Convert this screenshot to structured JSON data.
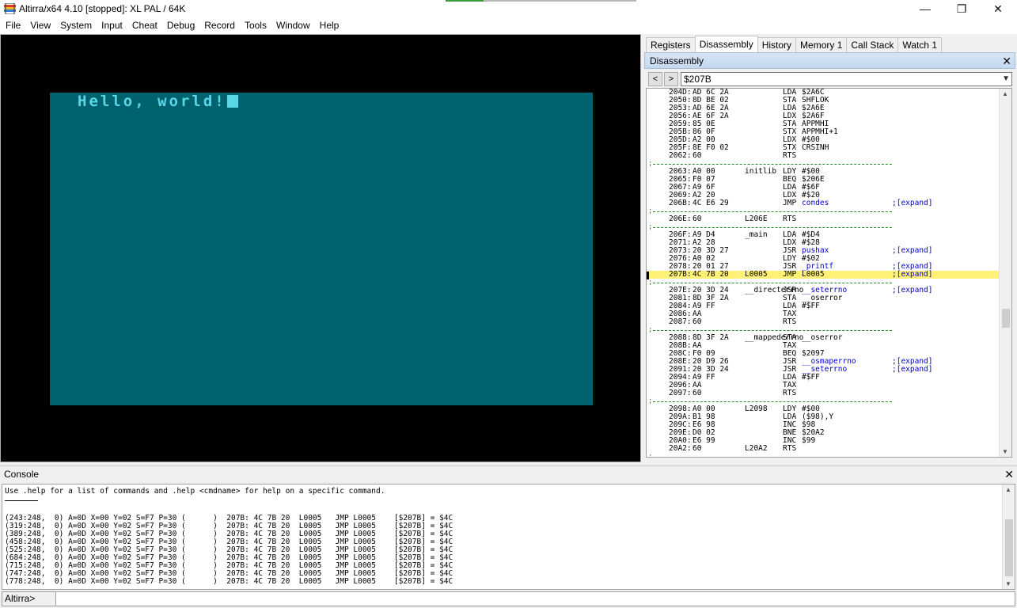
{
  "window": {
    "title": "Altirra/x64 4.10 [stopped]: XL PAL / 64K",
    "minimize": "—",
    "restore": "❐",
    "close": "✕"
  },
  "menu": [
    "File",
    "View",
    "System",
    "Input",
    "Cheat",
    "Debug",
    "Record",
    "Tools",
    "Window",
    "Help"
  ],
  "screen": {
    "text": "Hello, world!",
    "background_color": "#00616f",
    "text_color": "#5ad6e6"
  },
  "tabs": [
    "Registers",
    "Disassembly",
    "History",
    "Memory 1",
    "Call Stack",
    "Watch 1"
  ],
  "active_tab": "Disassembly",
  "disasm": {
    "title": "Disassembly",
    "close": "✕",
    "back": "<",
    "forward": ">",
    "address": "$207B",
    "highlight_color": "#fff176",
    "lines": [
      {
        "t": "code",
        "addr": "204D:",
        "bytes": "AD 6C 2A",
        "label": "",
        "op": "LDA",
        "arg": "$2A6C",
        "exp": ""
      },
      {
        "t": "code",
        "addr": "2050:",
        "bytes": "8D BE 02",
        "label": "",
        "op": "STA",
        "arg": "SHFLOK",
        "exp": ""
      },
      {
        "t": "code",
        "addr": "2053:",
        "bytes": "AD 6E 2A",
        "label": "",
        "op": "LDA",
        "arg": "$2A6E",
        "exp": ""
      },
      {
        "t": "code",
        "addr": "2056:",
        "bytes": "AE 6F 2A",
        "label": "",
        "op": "LDX",
        "arg": "$2A6F",
        "exp": ""
      },
      {
        "t": "code",
        "addr": "2059:",
        "bytes": "85 0E",
        "label": "",
        "op": "STA",
        "arg": "APPMHI",
        "exp": ""
      },
      {
        "t": "code",
        "addr": "205B:",
        "bytes": "86 0F",
        "label": "",
        "op": "STX",
        "arg": "APPMHI+1",
        "exp": ""
      },
      {
        "t": "code",
        "addr": "205D:",
        "bytes": "A2 00",
        "label": "",
        "op": "LDX",
        "arg": "#$00",
        "exp": ""
      },
      {
        "t": "code",
        "addr": "205F:",
        "bytes": "8E F0 02",
        "label": "",
        "op": "STX",
        "arg": "CRSINH",
        "exp": ""
      },
      {
        "t": "code",
        "addr": "2062:",
        "bytes": "60",
        "label": "",
        "op": "RTS",
        "arg": "",
        "exp": ""
      },
      {
        "t": "sep"
      },
      {
        "t": "code",
        "addr": "2063:",
        "bytes": "A0 00",
        "label": "initlib",
        "op": "LDY",
        "arg": "#$00",
        "exp": ""
      },
      {
        "t": "code",
        "addr": "2065:",
        "bytes": "F0 07",
        "label": "",
        "op": "BEQ",
        "arg": "$206E",
        "exp": ""
      },
      {
        "t": "code",
        "addr": "2067:",
        "bytes": "A9 6F",
        "label": "",
        "op": "LDA",
        "arg": "#$6F",
        "exp": ""
      },
      {
        "t": "code",
        "addr": "2069:",
        "bytes": "A2 20",
        "label": "",
        "op": "LDX",
        "arg": "#$20",
        "exp": ""
      },
      {
        "t": "code",
        "addr": "206B:",
        "bytes": "4C E6 29",
        "label": "",
        "op": "JMP",
        "arg": "condes",
        "sym": true,
        "exp": ";[expand]"
      },
      {
        "t": "sep"
      },
      {
        "t": "code",
        "addr": "206E:",
        "bytes": "60",
        "label": "L206E",
        "op": "RTS",
        "arg": "",
        "exp": ""
      },
      {
        "t": "sep"
      },
      {
        "t": "code",
        "addr": "206F:",
        "bytes": "A9 D4",
        "label": "_main",
        "op": "LDA",
        "arg": "#$D4",
        "exp": ""
      },
      {
        "t": "code",
        "addr": "2071:",
        "bytes": "A2 28",
        "label": "",
        "op": "LDX",
        "arg": "#$28",
        "exp": ""
      },
      {
        "t": "code",
        "addr": "2073:",
        "bytes": "20 3D 27",
        "label": "",
        "op": "JSR",
        "arg": "pushax",
        "sym": true,
        "exp": ";[expand]"
      },
      {
        "t": "code",
        "addr": "2076:",
        "bytes": "A0 02",
        "label": "",
        "op": "LDY",
        "arg": "#$02",
        "exp": ""
      },
      {
        "t": "code",
        "addr": "2078:",
        "bytes": "20 01 27",
        "label": "",
        "op": "JSR",
        "arg": "_printf",
        "sym": true,
        "exp": ";[expand]"
      },
      {
        "t": "code",
        "addr": "207B:",
        "bytes": "4C 7B 20",
        "label": "L0005",
        "op": "JMP",
        "arg": "L0005",
        "exp": ";[expand]",
        "hl": true
      },
      {
        "t": "sep"
      },
      {
        "t": "code",
        "addr": "207E:",
        "bytes": "20 3D 24",
        "label": "__directerrno",
        "op": "JSR",
        "arg": "__seterrno",
        "sym": true,
        "exp": ";[expand]"
      },
      {
        "t": "code",
        "addr": "2081:",
        "bytes": "8D 3F 2A",
        "label": "",
        "op": "STA",
        "arg": "__oserror",
        "exp": ""
      },
      {
        "t": "code",
        "addr": "2084:",
        "bytes": "A9 FF",
        "label": "",
        "op": "LDA",
        "arg": "#$FF",
        "exp": ""
      },
      {
        "t": "code",
        "addr": "2086:",
        "bytes": "AA",
        "label": "",
        "op": "TAX",
        "arg": "",
        "exp": ""
      },
      {
        "t": "code",
        "addr": "2087:",
        "bytes": "60",
        "label": "",
        "op": "RTS",
        "arg": "",
        "exp": ""
      },
      {
        "t": "sep"
      },
      {
        "t": "code",
        "addr": "2088:",
        "bytes": "8D 3F 2A",
        "label": "__mappederrno",
        "op": "STA",
        "arg": "__oserror",
        "exp": ""
      },
      {
        "t": "code",
        "addr": "208B:",
        "bytes": "AA",
        "label": "",
        "op": "TAX",
        "arg": "",
        "exp": ""
      },
      {
        "t": "code",
        "addr": "208C:",
        "bytes": "F0 09",
        "label": "",
        "op": "BEQ",
        "arg": "$2097",
        "exp": ""
      },
      {
        "t": "code",
        "addr": "208E:",
        "bytes": "20 D9 26",
        "label": "",
        "op": "JSR",
        "arg": "__osmaperrno",
        "sym": true,
        "exp": ";[expand]"
      },
      {
        "t": "code",
        "addr": "2091:",
        "bytes": "20 3D 24",
        "label": "",
        "op": "JSR",
        "arg": "__seterrno",
        "sym": true,
        "exp": ";[expand]"
      },
      {
        "t": "code",
        "addr": "2094:",
        "bytes": "A9 FF",
        "label": "",
        "op": "LDA",
        "arg": "#$FF",
        "exp": ""
      },
      {
        "t": "code",
        "addr": "2096:",
        "bytes": "AA",
        "label": "",
        "op": "TAX",
        "arg": "",
        "exp": ""
      },
      {
        "t": "code",
        "addr": "2097:",
        "bytes": "60",
        "label": "",
        "op": "RTS",
        "arg": "",
        "exp": ""
      },
      {
        "t": "sep"
      },
      {
        "t": "code",
        "addr": "2098:",
        "bytes": "A0 00",
        "label": "L2098",
        "op": "LDY",
        "arg": "#$00",
        "exp": ""
      },
      {
        "t": "code",
        "addr": "209A:",
        "bytes": "B1 98",
        "label": "",
        "op": "LDA",
        "arg": "($98),Y",
        "exp": ""
      },
      {
        "t": "code",
        "addr": "209C:",
        "bytes": "E6 98",
        "label": "",
        "op": "INC",
        "arg": "$98",
        "exp": ""
      },
      {
        "t": "code",
        "addr": "209E:",
        "bytes": "D0 02",
        "label": "",
        "op": "BNE",
        "arg": "$20A2",
        "exp": ""
      },
      {
        "t": "code",
        "addr": "20A0:",
        "bytes": "E6 99",
        "label": "",
        "op": "INC",
        "arg": "$99",
        "exp": ""
      },
      {
        "t": "code",
        "addr": "20A2:",
        "bytes": "60",
        "label": "L20A2",
        "op": "RTS",
        "arg": "",
        "exp": ""
      },
      {
        "t": "sep"
      }
    ]
  },
  "console": {
    "title": "Console",
    "close": "✕",
    "help": "Use .help for a list of commands and .help <cmdname> for help on a specific command.",
    "lines": [
      "(243:248,  0) A=0D X=00 Y=02 S=F7 P=30 (      )  207B: 4C 7B 20  L0005   JMP L0005    [$207B] = $4C",
      "(319:248,  0) A=0D X=00 Y=02 S=F7 P=30 (      )  207B: 4C 7B 20  L0005   JMP L0005    [$207B] = $4C",
      "(389:248,  0) A=0D X=00 Y=02 S=F7 P=30 (      )  207B: 4C 7B 20  L0005   JMP L0005    [$207B] = $4C",
      "(458:248,  0) A=0D X=00 Y=02 S=F7 P=30 (      )  207B: 4C 7B 20  L0005   JMP L0005    [$207B] = $4C",
      "(525:248,  0) A=0D X=00 Y=02 S=F7 P=30 (      )  207B: 4C 7B 20  L0005   JMP L0005    [$207B] = $4C",
      "(684:248,  0) A=0D X=00 Y=02 S=F7 P=30 (      )  207B: 4C 7B 20  L0005   JMP L0005    [$207B] = $4C",
      "(715:248,  0) A=0D X=00 Y=02 S=F7 P=30 (      )  207B: 4C 7B 20  L0005   JMP L0005    [$207B] = $4C",
      "(747:248,  0) A=0D X=00 Y=02 S=F7 P=30 (      )  207B: 4C 7B 20  L0005   JMP L0005    [$207B] = $4C",
      "(778:248,  0) A=0D X=00 Y=02 S=F7 P=30 (      )  207B: 4C 7B 20  L0005   JMP L0005    [$207B] = $4C"
    ],
    "prompt": "Altirra>",
    "input_value": ""
  }
}
